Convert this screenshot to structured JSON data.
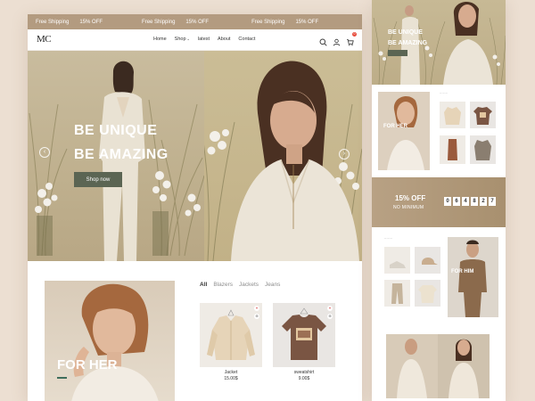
{
  "promo": {
    "groups": [
      {
        "a": "Free Shipping",
        "b": "15% OFF"
      },
      {
        "a": "Free Shipping",
        "b": "15% OFF"
      },
      {
        "a": "Free Shipping",
        "b": "15% OFF"
      }
    ]
  },
  "brand": {
    "logo": "MC"
  },
  "nav": {
    "items": [
      "Home",
      "Shop",
      "latest",
      "About",
      "Contact"
    ],
    "cart_count": "0"
  },
  "hero": {
    "title_line1": "BE UNIQUE",
    "title_line2": "BE AMAZING",
    "cta": "Shop now",
    "prev": "‹",
    "next": "›"
  },
  "collection": {
    "title": "FOR HER",
    "filters": [
      "All",
      "Blazers",
      "Jackets",
      "Jeans"
    ]
  },
  "products": [
    {
      "name": "Jacket",
      "price": "15.00$"
    },
    {
      "name": "sweatshirt",
      "price": "9.00$"
    }
  ],
  "side": {
    "hero_line1": "BE UNIQUE",
    "hero_line2": "BE AMAZING",
    "for_her": "FOR HER",
    "offer_title": "15% OFF",
    "offer_sub": "NO MINIMUM",
    "timer": [
      "0",
      "6",
      "4",
      "8",
      "2",
      "7"
    ],
    "for_him": "FOR HIM"
  },
  "colors": {
    "promo_bar": "#b39b80",
    "accent_button": "#5b6553",
    "background": "#ecdfd2"
  }
}
